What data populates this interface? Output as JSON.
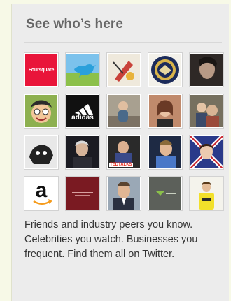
{
  "widget": {
    "title": "See who’s here",
    "description": "Friends and industry peers you know. Celebrities you watch. Businesses you frequent. Find them all on Twitter."
  },
  "tiles": [
    {
      "name": "foursquare-logo",
      "label": "Foursquare",
      "bg": "#e9153a"
    },
    {
      "name": "twitter-bird-logo",
      "label": "",
      "bg": "#6fb9e3"
    },
    {
      "name": "illustration-avatar",
      "label": "",
      "bg": "#e9e3d6"
    },
    {
      "name": "government-seal-avatar",
      "label": "",
      "bg": "#1c2b5a"
    },
    {
      "name": "bearded-man-avatar",
      "label": "",
      "bg": "#3a3230"
    },
    {
      "name": "cartoon-face-avatar",
      "label": "",
      "bg": "#7a9a4e"
    },
    {
      "name": "adidas-logo",
      "label": "adidas",
      "bg": "#111111"
    },
    {
      "name": "child-photo-avatar",
      "label": "",
      "bg": "#9a8e7c"
    },
    {
      "name": "woman-portrait-avatar",
      "label": "",
      "bg": "#b87a5e"
    },
    {
      "name": "family-photo-avatar",
      "label": "",
      "bg": "#6e6a60"
    },
    {
      "name": "black-white-sketch-avatar",
      "label": "",
      "bg": "#444444"
    },
    {
      "name": "man-dark-portrait-avatar",
      "label": "",
      "bg": "#1e1e24"
    },
    {
      "name": "ted-speaker-avatar",
      "label": "TEDTALKS",
      "bg": "#2a2a2a"
    },
    {
      "name": "man-blue-shirt-avatar",
      "label": "",
      "bg": "#4a6aa8"
    },
    {
      "name": "woman-union-flag-avatar",
      "label": "",
      "bg": "#b8262e"
    },
    {
      "name": "amazon-logo",
      "label": "a",
      "bg": "#ffffff"
    },
    {
      "name": "dark-red-brand-logo",
      "label": "",
      "bg": "#7a1a22"
    },
    {
      "name": "man-suit-portrait-avatar",
      "label": "",
      "bg": "#8c9aa8"
    },
    {
      "name": "green-brand-logo",
      "label": "",
      "bg": "#5a5e58"
    },
    {
      "name": "yellow-shirt-person-avatar",
      "label": "",
      "bg": "#f2f1ea"
    }
  ]
}
